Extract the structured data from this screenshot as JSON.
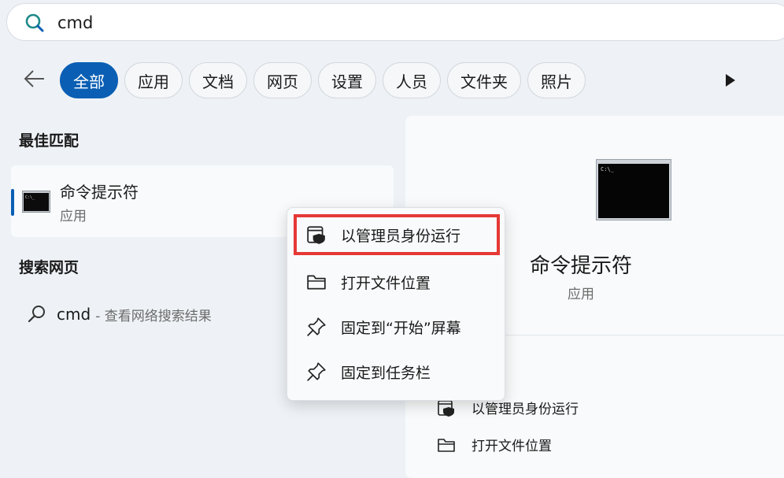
{
  "search": {
    "value": "cmd",
    "icon": "search-icon"
  },
  "filters": {
    "items": [
      {
        "label": "全部",
        "active": true
      },
      {
        "label": "应用"
      },
      {
        "label": "文档"
      },
      {
        "label": "网页"
      },
      {
        "label": "设置"
      },
      {
        "label": "人员"
      },
      {
        "label": "文件夹"
      },
      {
        "label": "照片"
      }
    ]
  },
  "best_match": {
    "section_title": "最佳匹配",
    "name": "命令提示符",
    "type": "应用",
    "icon": "terminal-icon"
  },
  "web_search": {
    "section_title": "搜索网页",
    "query": "cmd",
    "hint": "- 查看网络搜索结果"
  },
  "context_menu": {
    "items": [
      {
        "label": "以管理员身份运行",
        "icon": "shield-window-icon"
      },
      {
        "label": "打开文件位置",
        "icon": "folder-icon"
      },
      {
        "label": "固定到“开始”屏幕",
        "icon": "pin-icon"
      },
      {
        "label": "固定到任务栏",
        "icon": "pin-icon"
      }
    ]
  },
  "preview": {
    "title": "命令提示符",
    "type": "应用",
    "actions": [
      {
        "label": "以管理员身份运行",
        "icon": "shield-window-icon"
      },
      {
        "label": "打开文件位置",
        "icon": "folder-icon"
      }
    ]
  },
  "colors": {
    "accent": "#0a5fb4",
    "highlight_border": "#e53935",
    "search_icon": "#1f8a8a"
  }
}
